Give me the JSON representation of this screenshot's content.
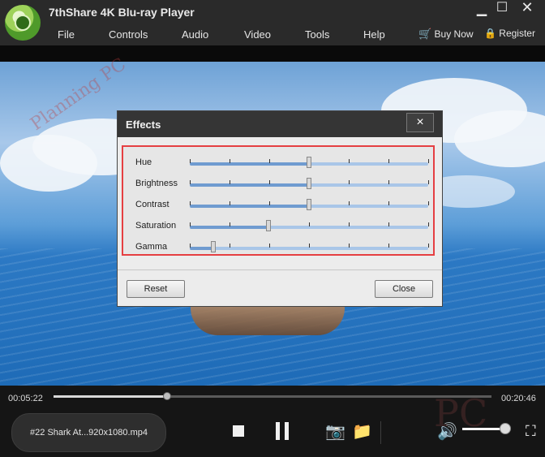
{
  "app": {
    "title": "7thShare 4K Blu-ray Player",
    "menu": [
      "File",
      "Controls",
      "Audio",
      "Video",
      "Tools",
      "Help"
    ],
    "buy_now": "Buy Now",
    "register": "Register"
  },
  "effects_dialog": {
    "title": "Effects",
    "close_icon": "×",
    "sliders": [
      {
        "label": "Hue",
        "value": 0.5
      },
      {
        "label": "Brightness",
        "value": 0.5
      },
      {
        "label": "Contrast",
        "value": 0.5
      },
      {
        "label": "Saturation",
        "value": 0.33
      },
      {
        "label": "Gamma",
        "value": 0.1
      }
    ],
    "reset_label": "Reset",
    "close_label": "Close"
  },
  "playback": {
    "elapsed": "00:05:22",
    "total": "00:20:46",
    "progress": 0.26,
    "file_name": "#22 Shark At...920x1080.mp4",
    "volume": 0.85
  },
  "icons": {
    "logo": "app-logo-icon",
    "minimize": "minimize-icon",
    "maximize": "maximize-icon",
    "close": "close-icon",
    "cart": "cart-icon",
    "lock": "lock-icon",
    "stop": "stop-icon",
    "pause": "pause-icon",
    "snapshot": "camera-icon",
    "open_folder": "folder-icon",
    "volume": "volume-icon",
    "fullscreen": "fullscreen-icon"
  },
  "colors": {
    "accent_red": "#e53f42",
    "titlebar": "#2a2a2a",
    "slider_fill": "#6f9bd0"
  }
}
